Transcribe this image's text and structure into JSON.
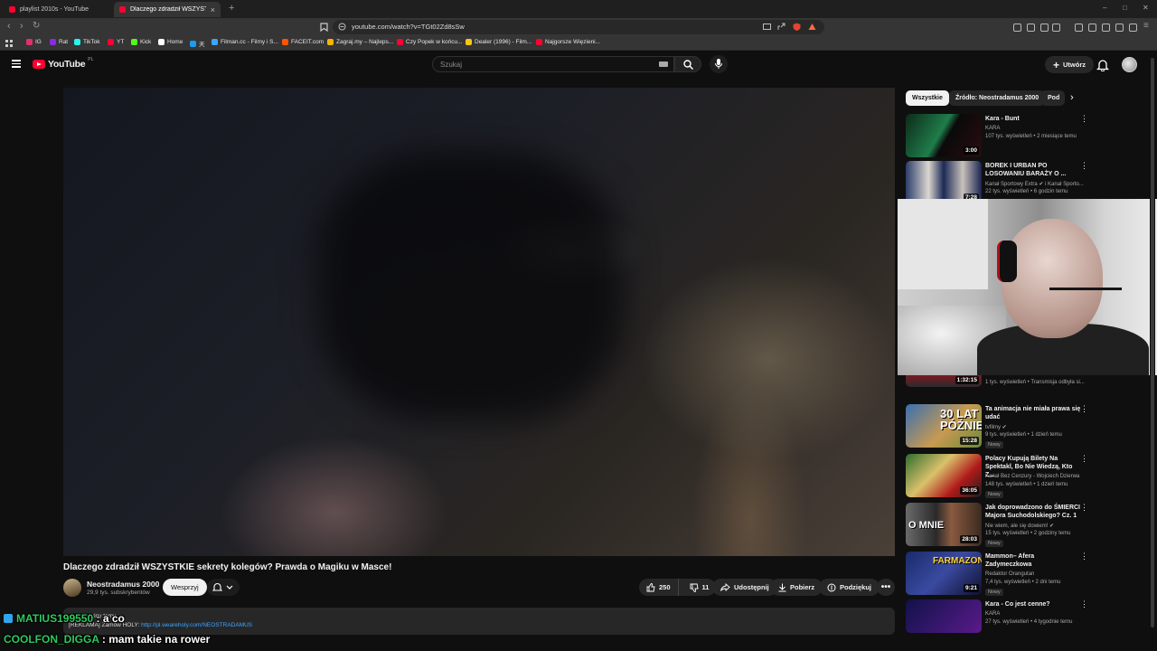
{
  "browser": {
    "tabs": [
      {
        "title": "playlist 2010s - YouTube"
      },
      {
        "title": "Dlaczego zdradził WSZYSTKIE se"
      }
    ],
    "url": "youtube.com/watch?v=TGt02Zd8sSw",
    "bookmarks": [
      {
        "label": "IG",
        "color": "#e1306c"
      },
      {
        "label": "Rat",
        "color": "#8a2be2"
      },
      {
        "label": "TikTok",
        "color": "#25f4ee"
      },
      {
        "label": "YT",
        "color": "#ff0033"
      },
      {
        "label": "Kick",
        "color": "#53fc18"
      },
      {
        "label": "Home",
        "color": "#ffffff"
      },
      {
        "label": "天",
        "color": "#1d9bf0"
      },
      {
        "label": "Filman.cc - Filmy i S...",
        "color": "#3ea6ff"
      },
      {
        "label": "FACEIT.com",
        "color": "#ff5500"
      },
      {
        "label": "Zagraj.my – Najleps...",
        "color": "#f5b400"
      },
      {
        "label": "Czy Popek w końcu...",
        "color": "#ff0033"
      },
      {
        "label": "Dealer (1996) - Film...",
        "color": "#f5c518"
      },
      {
        "label": "Najgorsze Więzieni...",
        "color": "#ff0033"
      }
    ]
  },
  "header": {
    "logo_text": "YouTube",
    "country": "PL",
    "search_placeholder": "Szukaj",
    "create_label": "Utwórz"
  },
  "video": {
    "title": "Dlaczego zdradził WSZYSTKIE sekrety kolegów? Prawda o Magiku w Masce!",
    "channel": "Neostradamus 2000",
    "subscribers": "29,9 tys. subskrybentów",
    "support_label": "Wesprzyj",
    "likes": "250",
    "dislikes": "11",
    "share_label": "Udostępnij",
    "download_label": "Pobierz",
    "thanks_label": "Podziękuj",
    "description_meta": "godziny temu",
    "description_ad_prefix": "[REKLAMA] Zamów HOLY: ",
    "description_ad_link": "http://pl.weareholy.com/NEOSTRADAMUS"
  },
  "sidebar": {
    "chips": [
      "Wszystkie",
      "Źródło: Neostradamus 2000",
      "Pod"
    ],
    "recommendations": [
      {
        "title": "Kara - Bunt",
        "channel": "KARA",
        "meta": "107 tys. wyświetleń • 2 miesiące temu",
        "duration": "3:00",
        "thumb": "",
        "new": ""
      },
      {
        "title": "BOREK I URBAN PO LOSOWANIU BARAŻY O ...",
        "channel": "Kanał Sportowy Extra ✔ i Kanał Sporto...",
        "meta": "22 tys. wyświetleń • 6 godzin temu",
        "duration": "7:28",
        "thumb": "",
        "new": ""
      },
      {
        "title": "",
        "channel": "",
        "meta": "1 tys. wyświetleń • Transmisja odbyła si...",
        "duration": "1:32:15",
        "thumb": "",
        "new": ""
      },
      {
        "title": "Ta animacja nie miała prawa się udać",
        "channel": "tvfilmy ✔",
        "meta": "9 tys. wyświetleń • 1 dzień temu",
        "duration": "15:28",
        "thumb": "30 LAT PÓŹNIEJ",
        "new": "Nowy"
      },
      {
        "title": "Polacy Kupują Bilety Na Spektakl, Bo Nie Wiedzą, Kto Z...",
        "channel": "Kanał Bez Cenzury - Wojciech Dzierwa",
        "meta": "148 tys. wyświetleń • 1 dzień temu",
        "duration": "36:05",
        "thumb": "",
        "new": "Nowy"
      },
      {
        "title": "Jak doprowadzono do ŚMIERCI Majora Suchodolskiego? Cz. 1",
        "channel": "Nie wiem, ale się dowiem! ✔",
        "meta": "15 tys. wyświetleń • 2 godziny temu",
        "duration": "28:03",
        "thumb": "O MNIE",
        "new": "Nowy"
      },
      {
        "title": "Mammon– Afera Zadymeczkowa",
        "channel": "Redaktor Orangutan",
        "meta": "7,4 tys. wyświetleń • 2 dni temu",
        "duration": "9:21",
        "thumb": "FARMAZON?",
        "new": "Nowy"
      },
      {
        "title": "Kara - Co jest cenne?",
        "channel": "KARA",
        "meta": "27 tys. wyświetleń • 4 tygodnie temu",
        "duration": "",
        "thumb": "",
        "new": ""
      }
    ]
  },
  "chat": [
    {
      "user": "MATIUS199550",
      "message": "a co",
      "color": "#2fc95f"
    },
    {
      "user": "COOLFON_DIGGA",
      "message": "mam takie na rower",
      "color": "#2fc95f"
    }
  ],
  "colors": {
    "accent": "#ff0033",
    "link": "#3ea6ff",
    "bg": "#0f0f0f"
  }
}
